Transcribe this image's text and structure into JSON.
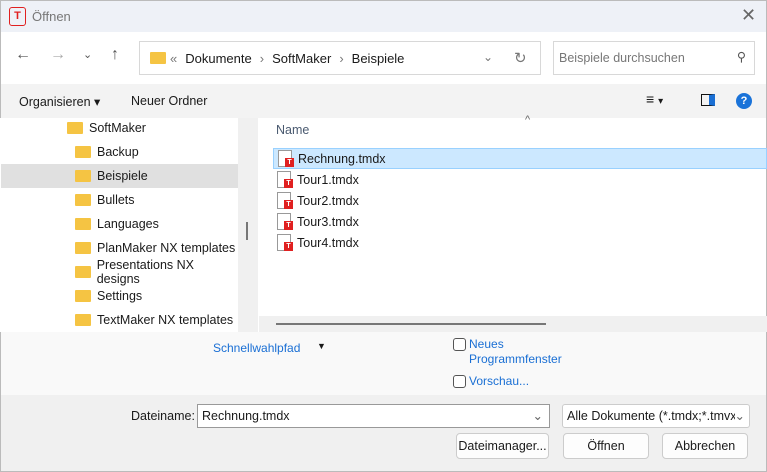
{
  "window": {
    "title": "Öffnen",
    "app_icon": "T"
  },
  "address": {
    "crumbs": [
      "Dokumente",
      "SoftMaker",
      "Beispiele"
    ],
    "overflow": "«",
    "search_placeholder": "Beispiele durchsuchen"
  },
  "toolbar": {
    "organize": "Organisieren",
    "new_folder": "Neuer Ordner"
  },
  "tree": [
    {
      "label": "SoftMaker"
    },
    {
      "label": "Backup"
    },
    {
      "label": "Beispiele"
    },
    {
      "label": "Bullets"
    },
    {
      "label": "Languages"
    },
    {
      "label": "PlanMaker NX templates"
    },
    {
      "label": "Presentations NX designs"
    },
    {
      "label": "Settings"
    },
    {
      "label": "TextMaker NX templates"
    }
  ],
  "files": {
    "column": "Name",
    "items": [
      "Rechnung.tmdx",
      "Tour1.tmdx",
      "Tour2.tmdx",
      "Tour3.tmdx",
      "Tour4.tmdx"
    ]
  },
  "options": {
    "quickpath": "Schnellwahlpfad",
    "new_window_1": "Neues",
    "new_window_2": "Programmfenster",
    "preview": "Vorschau..."
  },
  "bottom": {
    "filename_label": "Dateiname:",
    "filename": "Rechnung.tmdx",
    "filter": "Alle Dokumente (*.tmdx;*.tmvx",
    "file_manager": "Dateimanager...",
    "open": "Öffnen",
    "cancel": "Abbrechen"
  }
}
